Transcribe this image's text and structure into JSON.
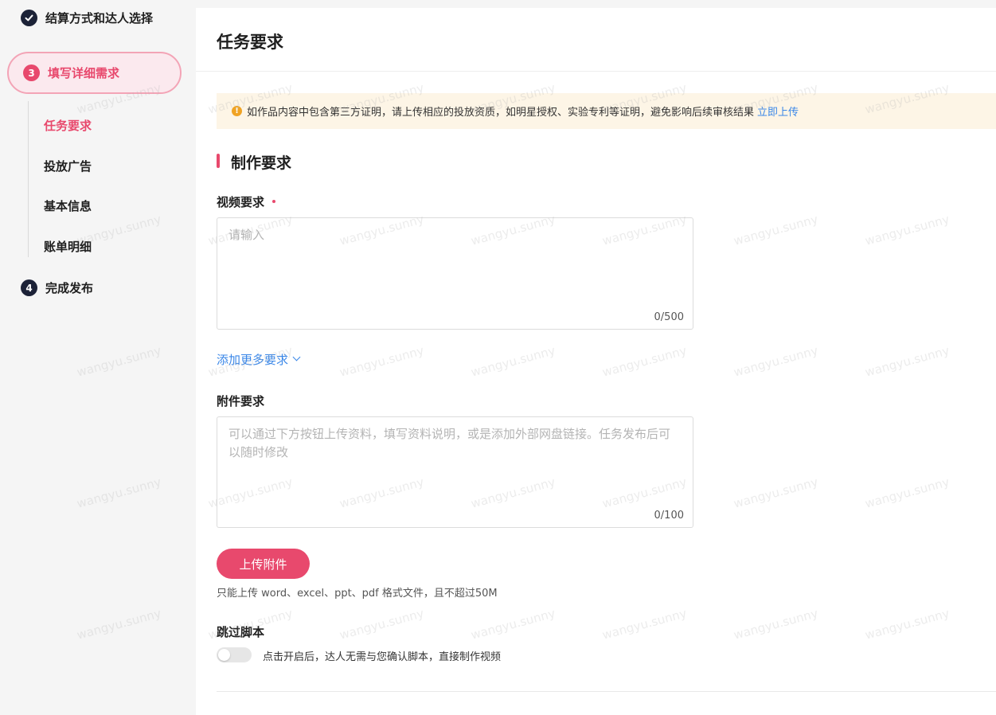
{
  "sidebar": {
    "steps": [
      {
        "label": "结算方式和达人选择",
        "state": "done"
      },
      {
        "number": "3",
        "label": "填写详细需求",
        "state": "active"
      },
      {
        "number": "4",
        "label": "完成发布",
        "state": "pending"
      }
    ],
    "sub_items": [
      {
        "label": "任务要求",
        "active": true
      },
      {
        "label": "投放广告",
        "active": false
      },
      {
        "label": "基本信息",
        "active": false
      },
      {
        "label": "账单明细",
        "active": false
      }
    ]
  },
  "main": {
    "title": "任务要求",
    "notice": {
      "icon": "warning-icon",
      "glyph": "!",
      "text": "如作品内容中包含第三方证明，请上传相应的投放资质，如明星授权、实验专利等证明，避免影响后续审核结果",
      "link": "立即上传"
    },
    "section_title": "制作要求",
    "video_requirement": {
      "label": "视频要求",
      "placeholder": "请输入",
      "counter": "0/500"
    },
    "add_more": "添加更多要求",
    "attachment_requirement": {
      "label": "附件要求",
      "placeholder": "可以通过下方按钮上传资料，填写资料说明，或是添加外部网盘链接。任务发布后可以随时修改",
      "counter": "0/100"
    },
    "upload_button": "上传附件",
    "upload_hint": "只能上传 word、excel、ppt、pdf 格式文件，且不超过50M",
    "skip_script": {
      "label": "跳过脚本",
      "description": "点击开启后，达人无需与您确认脚本，直接制作视频",
      "enabled": false
    }
  },
  "watermark": "wangyu.sunny",
  "colors": {
    "accent": "#e8496d",
    "link": "#3a87e8",
    "notice_bg": "#fdf5e6",
    "dark_step": "#1c2237"
  }
}
